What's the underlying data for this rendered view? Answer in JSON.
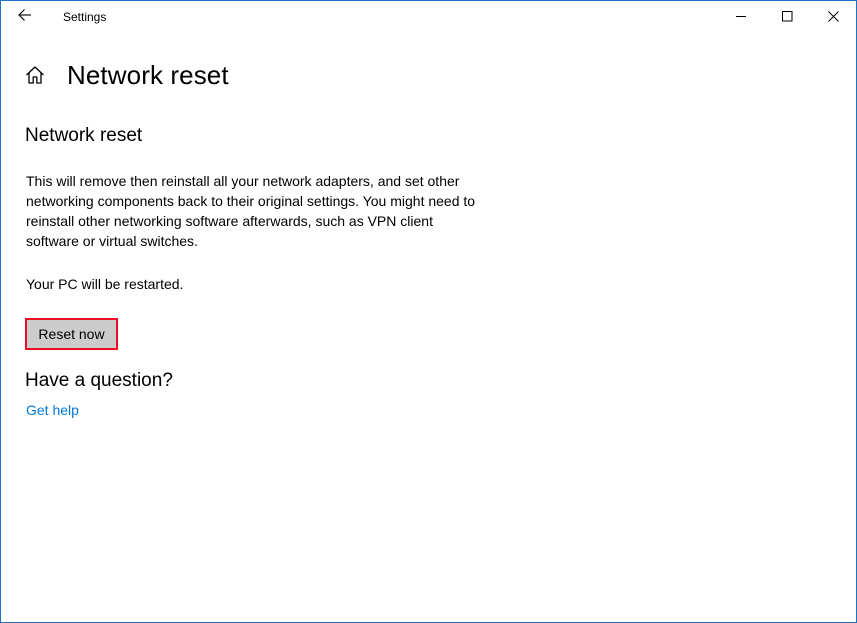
{
  "window": {
    "title": "Settings",
    "accent_color": "#0078d7",
    "border_color": "#1a73c7"
  },
  "titlebar": {
    "back_icon": "arrow-left-icon",
    "minimize_icon": "minimize-icon",
    "maximize_icon": "maximize-icon",
    "close_icon": "close-icon"
  },
  "header": {
    "home_icon": "home-icon",
    "title": "Network reset"
  },
  "section": {
    "title": "Network reset",
    "description": "This will remove then reinstall all your network adapters, and set other networking components back to their original settings. You might need to reinstall other networking software afterwards, such as VPN client software or virtual switches.",
    "restart_note": "Your PC will be restarted.",
    "button_label": "Reset now",
    "button_highlight_color": "#e81123"
  },
  "help": {
    "title": "Have a question?",
    "link_label": "Get help"
  }
}
